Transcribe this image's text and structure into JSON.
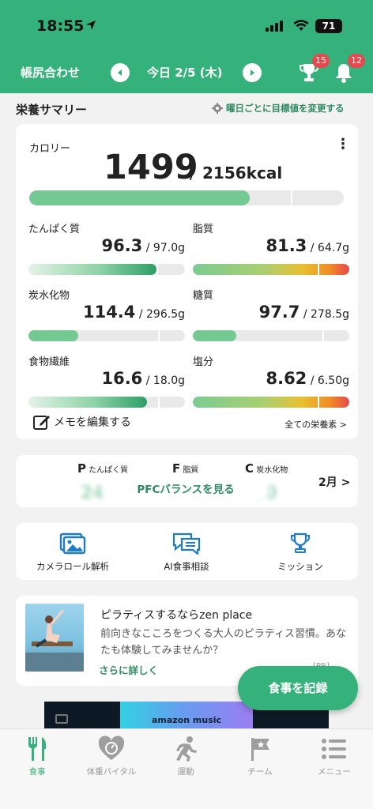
{
  "status_bar": {
    "time": "18:55",
    "battery": "71"
  },
  "header": {
    "diary_label": "帳尻合わせ",
    "date": "今日 2/5 (木)",
    "trophy_badge": "15",
    "bell_badge": "12"
  },
  "summary": {
    "title": "栄養サマリー",
    "goal_link": "曜日ごとに目標値を変更する",
    "calorie": {
      "label": "カロリー",
      "value": "1499",
      "separator": "/",
      "goal": "2156kcal",
      "progress": 0.7
    },
    "nutrients": [
      {
        "label": "たんぱく質",
        "value": "96.3",
        "goal": "/ 97.0g",
        "progress": 0.82,
        "style": "grad"
      },
      {
        "label": "脂質",
        "value": "81.3",
        "goal": "/ 64.7g",
        "progress": 1.0,
        "style": "over"
      },
      {
        "label": "炭水化物",
        "value": "114.4",
        "goal": "/ 296.5g",
        "progress": 0.32,
        "style": "plain"
      },
      {
        "label": "糖質",
        "value": "97.7",
        "goal": "/ 278.5g",
        "progress": 0.28,
        "style": "plain"
      },
      {
        "label": "食物繊維",
        "value": "16.6",
        "goal": "/ 18.0g",
        "progress": 0.76,
        "style": "grad"
      },
      {
        "label": "塩分",
        "value": "8.62",
        "goal": "/ 6.50g",
        "progress": 1.0,
        "style": "over"
      }
    ],
    "memo_label": "メモを編集する",
    "all_nutrients": "全ての栄養素 >"
  },
  "pfc": {
    "p_letter": "P",
    "p_label": "たんぱく質",
    "f_letter": "F",
    "f_label": "脂質",
    "c_letter": "C",
    "c_label": "炭水化物",
    "button": "PFCバランスを見る",
    "month": "2月 >"
  },
  "shortcuts": [
    {
      "label": "カメラロール解析",
      "icon": "camera-roll-icon"
    },
    {
      "label": "AI食事相談",
      "icon": "chat-icon"
    },
    {
      "label": "ミッション",
      "icon": "trophy-icon"
    }
  ],
  "ad": {
    "title": "ピラティスするならzen place",
    "description": "前向きなこころをつくる大人のピラティス習慣。あなたも体験してみませんか？",
    "more": "さらに詳しく",
    "pr": "[PR]"
  },
  "fab_label": "食事を記録",
  "banner_text": "amazon music",
  "tabs": [
    {
      "label": "食事",
      "icon": "fork-knife-icon",
      "active": true
    },
    {
      "label": "体重バイタル",
      "icon": "heart-icon",
      "active": false
    },
    {
      "label": "運動",
      "icon": "runner-icon",
      "active": false
    },
    {
      "label": "チーム",
      "icon": "flag-icon",
      "active": false
    },
    {
      "label": "メニュー",
      "icon": "menu-icon",
      "active": false
    }
  ],
  "colors": {
    "brand": "#35b27c",
    "accent_text": "#2f8a63",
    "badge": "#e5484d"
  }
}
